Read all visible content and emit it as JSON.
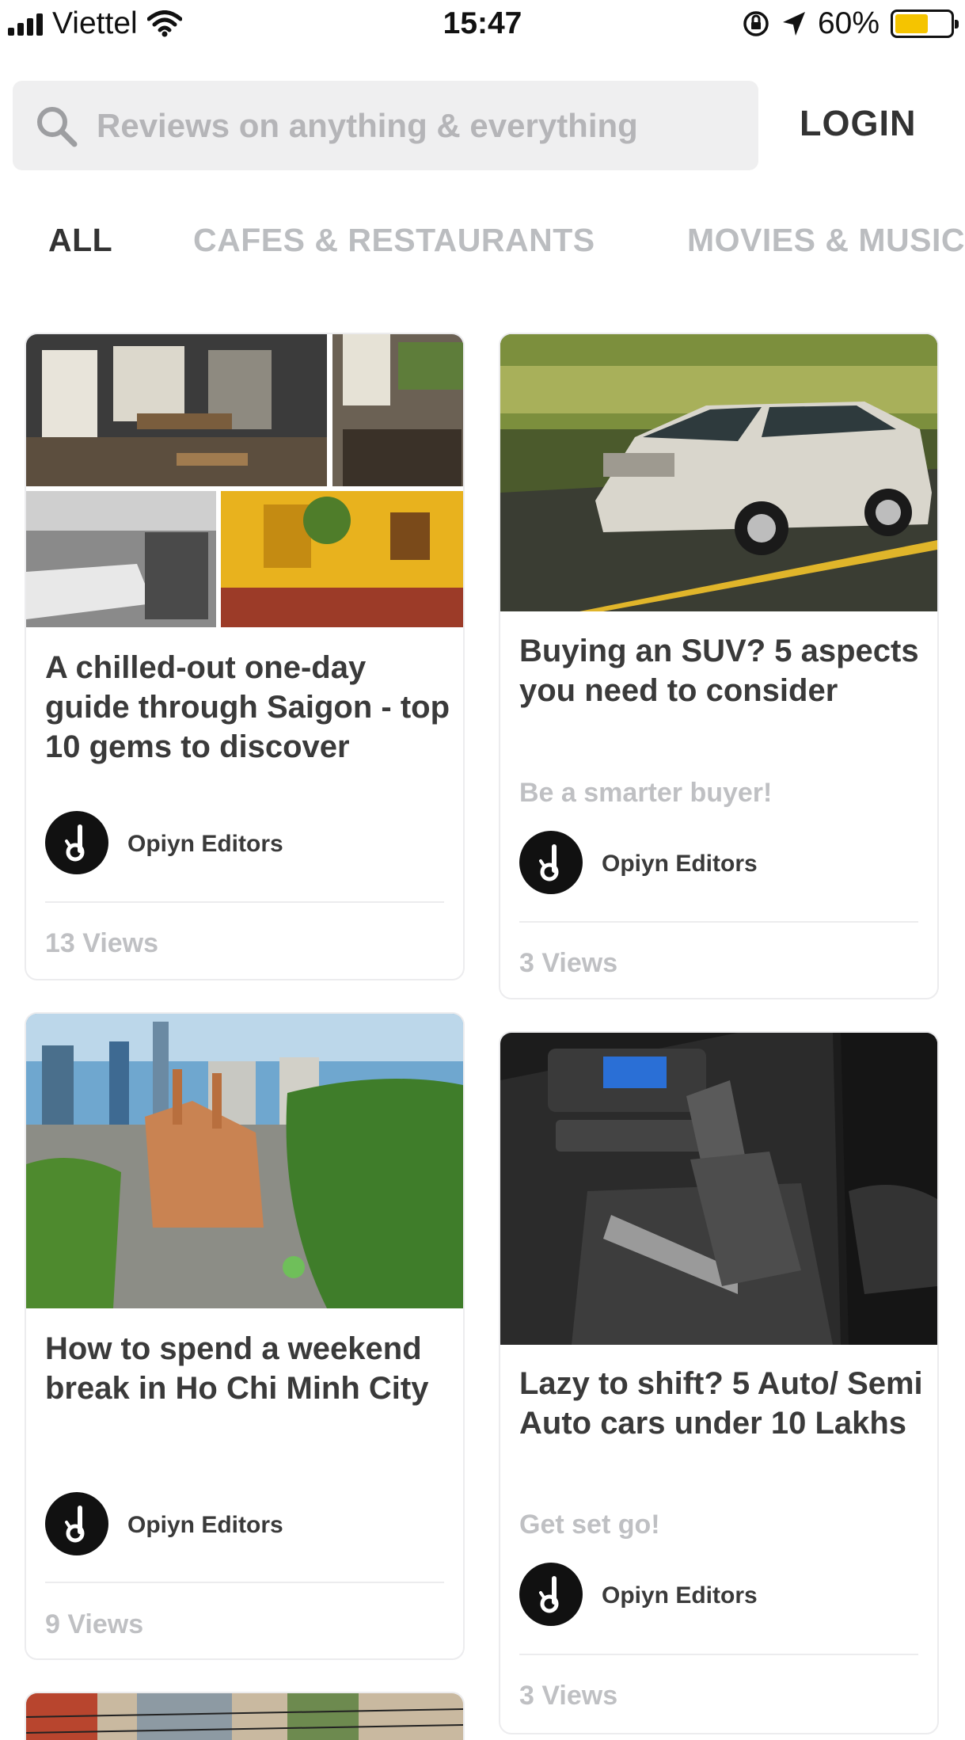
{
  "status_bar": {
    "carrier": "Viettel",
    "time": "15:47",
    "battery": "60%",
    "battery_level": 0.6,
    "battery_color": "#f5c400"
  },
  "search": {
    "placeholder": "Reviews on anything & everything",
    "icon": "search-icon"
  },
  "header": {
    "login_label": "LOGIN"
  },
  "tabs": [
    {
      "label": "ALL",
      "active": true
    },
    {
      "label": "CAFES & RESTAURANTS",
      "active": false
    },
    {
      "label": "MOVIES & MUSIC",
      "active": false
    }
  ],
  "cards": [
    {
      "title": "A chilled-out one-day guide through Saigon - top 10 gems to discover",
      "author": "Opiyn Editors",
      "views": "13 Views"
    },
    {
      "title": "Buying an SUV? 5 aspects you need to consider",
      "subtitle": "Be a smarter buyer!",
      "author": "Opiyn Editors",
      "views": "3 Views"
    },
    {
      "title": "How to spend a weekend break in Ho Chi Minh City",
      "author": "Opiyn Editors",
      "views": "9 Views"
    },
    {
      "title": "Lazy to shift? 5 Auto/ Semi Auto cars under 10 Lakhs",
      "subtitle": "Get set go!",
      "author": "Opiyn Editors",
      "views": "3 Views"
    }
  ],
  "colors": {
    "accent_text": "#333333",
    "muted_text": "#bbbdc0",
    "card_border": "#ececee",
    "search_bg": "#efeff0"
  }
}
